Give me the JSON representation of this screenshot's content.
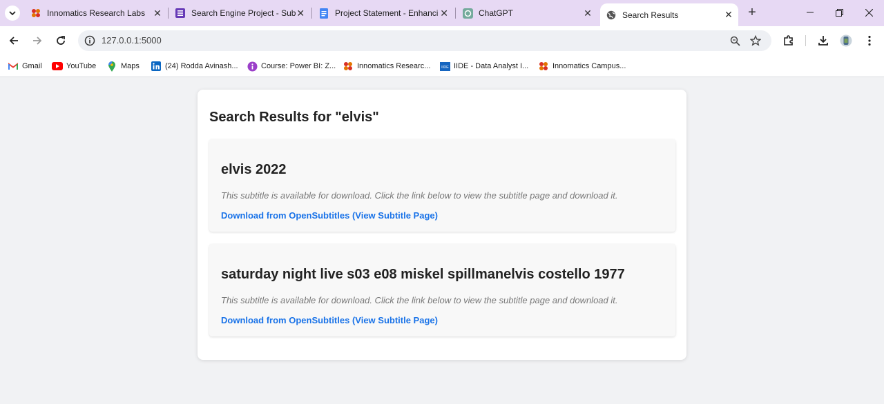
{
  "browser": {
    "tabs": [
      {
        "title": "Innomatics Research Labs",
        "icon": "innomatics-favicon",
        "active": false
      },
      {
        "title": "Search Engine Project - Subr",
        "icon": "forms-favicon",
        "active": false
      },
      {
        "title": "Project Statement - Enhancir",
        "icon": "docs-favicon",
        "active": false
      },
      {
        "title": "ChatGPT",
        "icon": "chatgpt-favicon",
        "active": false
      },
      {
        "title": "Search Results",
        "icon": "globe-icon",
        "active": true
      }
    ],
    "url": "127.0.0.1:5000",
    "bookmarks": [
      {
        "label": "Gmail",
        "icon": "gmail-icon"
      },
      {
        "label": "YouTube",
        "icon": "youtube-icon"
      },
      {
        "label": "Maps",
        "icon": "maps-icon"
      },
      {
        "label": "(24) Rodda Avinash...",
        "icon": "linkedin-icon"
      },
      {
        "label": "Course: Power BI: Z...",
        "icon": "course-icon"
      },
      {
        "label": "Innomatics Researc...",
        "icon": "innomatics-favicon"
      },
      {
        "label": "IIDE - Data Analyst I...",
        "icon": "iide-icon"
      },
      {
        "label": "Innomatics Campus...",
        "icon": "innomatics-favicon"
      }
    ]
  },
  "page": {
    "heading": "Search Results for \"elvis\"",
    "results": [
      {
        "title": "elvis 2022",
        "description": "This subtitle is available for download. Click the link below to view the subtitle page and download it.",
        "link": "Download from OpenSubtitles (View Subtitle Page)"
      },
      {
        "title": "saturday night live s03 e08 miskel spillmanelvis costello 1977",
        "description": "This subtitle is available for download. Click the link below to view the subtitle page and download it.",
        "link": "Download from OpenSubtitles (View Subtitle Page)"
      }
    ]
  },
  "colors": {
    "tabbar": "#e7d9f4",
    "link": "#1a73e8",
    "page_bg": "#f1f2f4"
  }
}
